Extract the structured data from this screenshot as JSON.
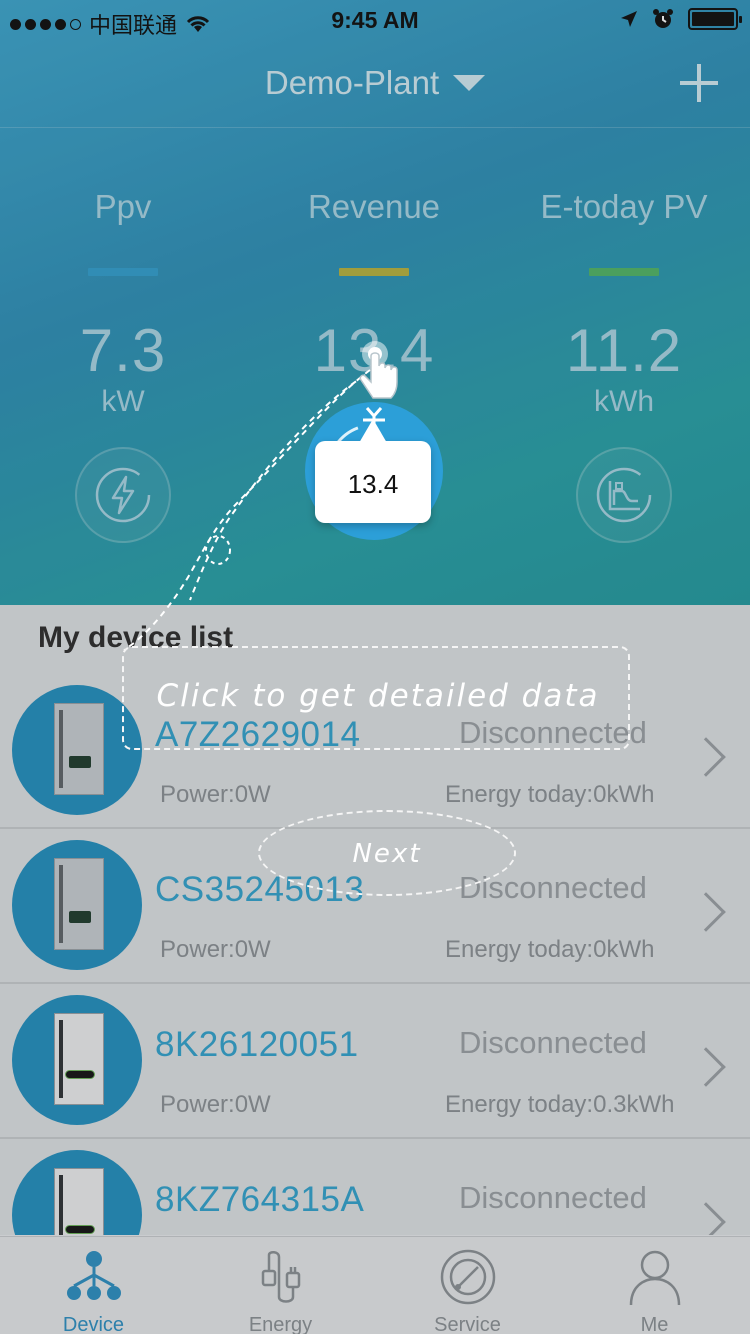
{
  "status_bar": {
    "carrier": "中国联通",
    "time": "9:45 AM"
  },
  "header": {
    "plant_name": "Demo-Plant",
    "add_icon": "plus-icon",
    "dropdown_icon": "caret-down-icon"
  },
  "metrics": [
    {
      "label": "Ppv",
      "value": "7.3",
      "unit": "kW",
      "bar_color": "#2f9fd0",
      "icon": "lightning-icon"
    },
    {
      "label": "Revenue",
      "value": "13.4",
      "unit": "",
      "bar_color": "#b7b23c",
      "icon": "currency-icon"
    },
    {
      "label": "E-today PV",
      "value": "11.2",
      "unit": "kWh",
      "bar_color": "#4fb564",
      "icon": "chart-icon"
    }
  ],
  "device_list": {
    "title": "My device list",
    "devices": [
      {
        "name": "A7Z2629014",
        "status": "Disconnected",
        "power": "Power:0W",
        "energy": "Energy today:0kWh",
        "model": "grey"
      },
      {
        "name": "CS35245013",
        "status": "Disconnected",
        "power": "Power:0W",
        "energy": "Energy today:0kWh",
        "model": "grey"
      },
      {
        "name": "8K26120051",
        "status": "Disconnected",
        "power": "Power:0W",
        "energy": "Energy today:0.3kWh",
        "model": "black"
      },
      {
        "name": "8KZ764315A",
        "status": "Disconnected",
        "power": "",
        "energy": "",
        "model": "black"
      }
    ]
  },
  "tabs": [
    {
      "label": "Device",
      "icon": "device-tree-icon",
      "active": true
    },
    {
      "label": "Energy",
      "icon": "plug-icon",
      "active": false
    },
    {
      "label": "Service",
      "icon": "service-icon",
      "active": false
    },
    {
      "label": "Me",
      "icon": "user-icon",
      "active": false
    }
  ],
  "guide": {
    "callout_value": "13.4",
    "hint": "Click to get detailed data",
    "next_label": "Next"
  },
  "colors": {
    "accent": "#2a8fc4",
    "device_name": "#2fa3cf"
  }
}
